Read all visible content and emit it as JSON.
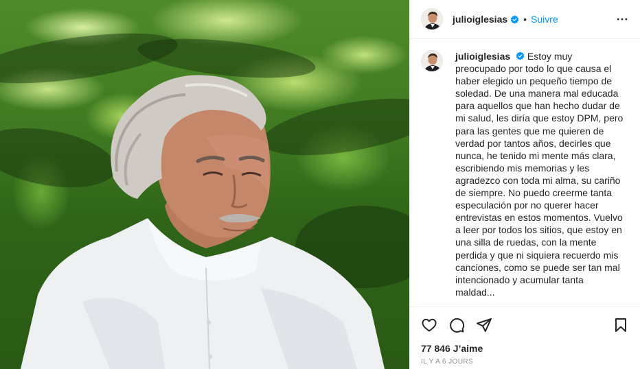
{
  "post": {
    "username": "julioiglesias",
    "follow_label": "Suivre",
    "separator": "•",
    "caption_username": "julioiglesias",
    "caption_text": "Estoy muy preocupado por todo lo que causa el haber elegido un pequeño tiempo de soledad. De una manera mal educada para aquellos que han hecho dudar de mi salud, les diría que estoy DPM, pero para las gentes que me quieren de verdad por tantos años, decirles que nunca, he tenido mi mente más clara, escribiendo mis memorias y les agradezco con toda mi alma, su cariño de siempre. No puedo creerme tanta especulación por no querer hacer entrevistas en estos momentos. Vuelvo a leer por todos los sitios, que estoy en una silla de ruedas, con la mente perdida y que ni siquiera recuerdo mis canciones, como se puede ser tan mal intencionado y acumular tanta maldad...",
    "likes": "77 846 J’aime",
    "time": "IL Y A 6 JOURS"
  },
  "colors": {
    "follow": "#0095f6",
    "verified": "#0095f6",
    "text": "#262626",
    "muted": "#8e8e8e"
  },
  "icons": {
    "verified": "verified-badge-icon",
    "more": "more-options-icon",
    "like": "heart-icon",
    "comment": "comment-icon",
    "share": "paper-plane-icon",
    "save": "bookmark-icon"
  }
}
